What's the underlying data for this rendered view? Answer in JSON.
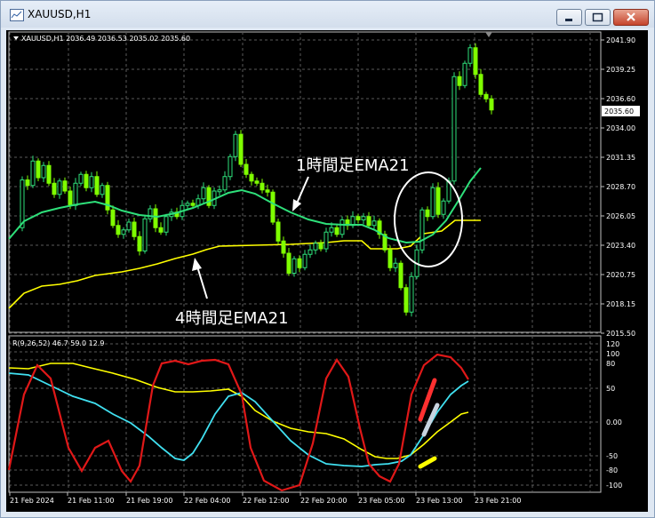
{
  "window": {
    "title": "XAUUSD,H1",
    "buttons": {
      "minimize": "minimize",
      "maximize": "maximize",
      "close": "close"
    }
  },
  "header": {
    "symbol_info": "XAUUSD,H1  2036.49 2036.53 2035.02 2035.60"
  },
  "price_axis": {
    "labels": [
      "2041.90",
      "2039.25",
      "2036.60",
      "2034.00",
      "2031.35",
      "2028.70",
      "2026.05",
      "2023.40",
      "2020.75",
      "2018.15",
      "2015.50"
    ],
    "current_price": "2035.60"
  },
  "annotations": {
    "ema_1h": "1時間足EMA21",
    "ema_4h": "4時間足EMA21"
  },
  "indicator": {
    "label": "R(9,26,52) 46.7 59.0 12.9",
    "axis_labels": [
      "120",
      "100",
      "80",
      "50",
      "0.00",
      "-50",
      "-80",
      "-100"
    ]
  },
  "time_axis": {
    "labels": [
      "21 Feb 2024",
      "21 Feb 11:00",
      "21 Feb 19:00",
      "22 Feb 04:00",
      "22 Feb 12:00",
      "22 Feb 20:00",
      "23 Feb 05:00",
      "23 Feb 13:00",
      "23 Feb 21:00"
    ]
  },
  "chart_data": [
    {
      "type": "candlestick",
      "series": [
        {
          "name": "1時間足EMA21",
          "color": "#2ee07a"
        },
        {
          "name": "4時間足EMA21",
          "color": "#ffff00"
        }
      ],
      "candle_colors": {
        "up": "#2ee07a",
        "down": "#7fff00"
      },
      "ylim": [
        2015.5,
        2042.6
      ],
      "grid": true,
      "last_close": 2035.6
    },
    {
      "type": "line",
      "series": [
        {
          "color": "#e01818",
          "last_value": 46.7
        },
        {
          "color": "#40e0f0",
          "last_value": 59.0
        },
        {
          "color": "#ffff00",
          "last_value": 12.9
        }
      ],
      "ylim": [
        -120,
        120
      ],
      "grid": true
    }
  ]
}
